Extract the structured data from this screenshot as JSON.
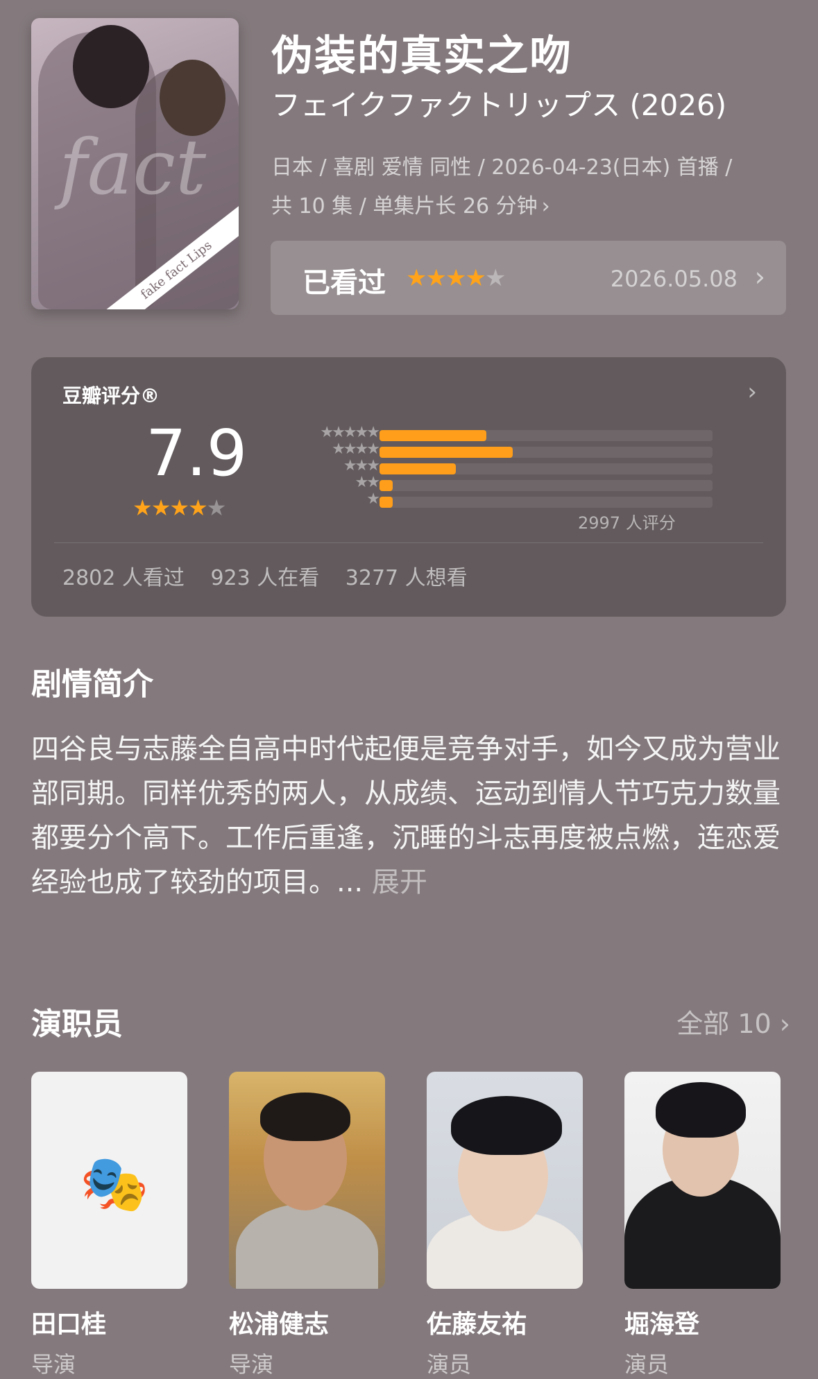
{
  "header": {
    "title": "伪装的真实之吻",
    "original_title": "フェイクファクトリップス (2026)",
    "meta_line1": "日本 / 喜剧 爱情 同性 / 2026-04-23(日本) 首播 /",
    "meta_line2": "共 10 集 / 单集片长 26 分钟",
    "poster_text": "fake fact Lips"
  },
  "watched": {
    "label": "已看过",
    "rating": 4,
    "date": "2026.05.08"
  },
  "rating": {
    "title": "豆瓣评分®",
    "score": "7.9",
    "stars": 4,
    "distribution": [
      0.32,
      0.4,
      0.23,
      0.04,
      0.04
    ],
    "count_text": "2997 人评分",
    "watched_text": "2802 人看过",
    "watching_text": "923 人在看",
    "want_text": "3277 人想看"
  },
  "synopsis": {
    "heading": "剧情简介",
    "text": "四谷良与志藤全自高中时代起便是竞争对手，如今又成为营业部同期。同样优秀的两人，从成绩、运动到情人节巧克力数量都要分个高下。工作后重逢，沉睡的斗志再度被点燃，连恋爱经验也成了较劲的项目。...",
    "more": "展开"
  },
  "cast": {
    "heading": "演职员",
    "all_label": "全部 10",
    "members": [
      {
        "name": "田口桂",
        "role": "导演"
      },
      {
        "name": "松浦健志",
        "role": "导演"
      },
      {
        "name": "佐藤友祐",
        "role": "演员"
      },
      {
        "name": "堀海登",
        "role": "演员"
      }
    ]
  },
  "icons": {
    "chevron": "chevron-right-icon",
    "placeholder": "theater-mask-icon"
  },
  "colors": {
    "background": "#847a7d",
    "card": "#625a5c",
    "star": "#ffa31a",
    "bar": "#ff9e1a"
  }
}
